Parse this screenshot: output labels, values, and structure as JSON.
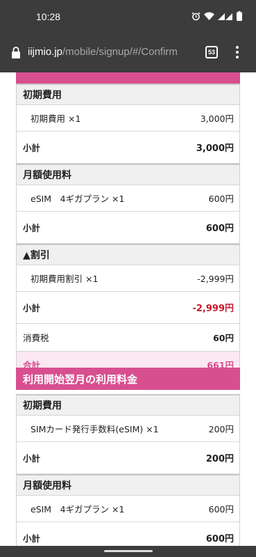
{
  "status_bar": {
    "time": "10:28"
  },
  "browser": {
    "url_host": "iijmio.jp",
    "url_path": "/mobile/signup/#/Confirm",
    "tab_count": "53"
  },
  "colors": {
    "accent": "#d84f8f",
    "negative": "#c8192b",
    "total_bg": "#fbe8f1",
    "chrome": "#3c3c3c"
  },
  "icons": [
    "lock-icon",
    "alarm-icon",
    "wifi-icon",
    "signal-icon",
    "battery-icon",
    "menu-icon"
  ],
  "first_month": {
    "initial": {
      "category": "初期費用",
      "item": "初期費用 ×1",
      "item_amount": "3,000円",
      "subtotal_label": "小計",
      "subtotal_amount": "3,000円"
    },
    "monthly": {
      "category": "月額使用料",
      "item": "eSIM　4ギガプラン ×1",
      "item_amount": "600円",
      "subtotal_label": "小計",
      "subtotal_amount": "600円"
    },
    "discount": {
      "category": "▲割引",
      "item": "初期費用割引 ×1",
      "item_amount": "-2,999円",
      "subtotal_label": "小計",
      "subtotal_amount": "-2,999円"
    },
    "tax": {
      "label": "消費税",
      "amount": "60円"
    },
    "total": {
      "label": "合計",
      "amount": "661円"
    }
  },
  "next_month": {
    "header": "利用開始翌月の利用料金",
    "initial": {
      "category": "初期費用",
      "item": "SIMカード発行手数料(eSIM) ×1",
      "item_amount": "200円",
      "subtotal_label": "小計",
      "subtotal_amount": "200円"
    },
    "monthly": {
      "category": "月額使用料",
      "item": "eSIM　4ギガプラン ×1",
      "item_amount": "600円",
      "subtotal_label": "小計",
      "subtotal_amount": "600円"
    }
  }
}
